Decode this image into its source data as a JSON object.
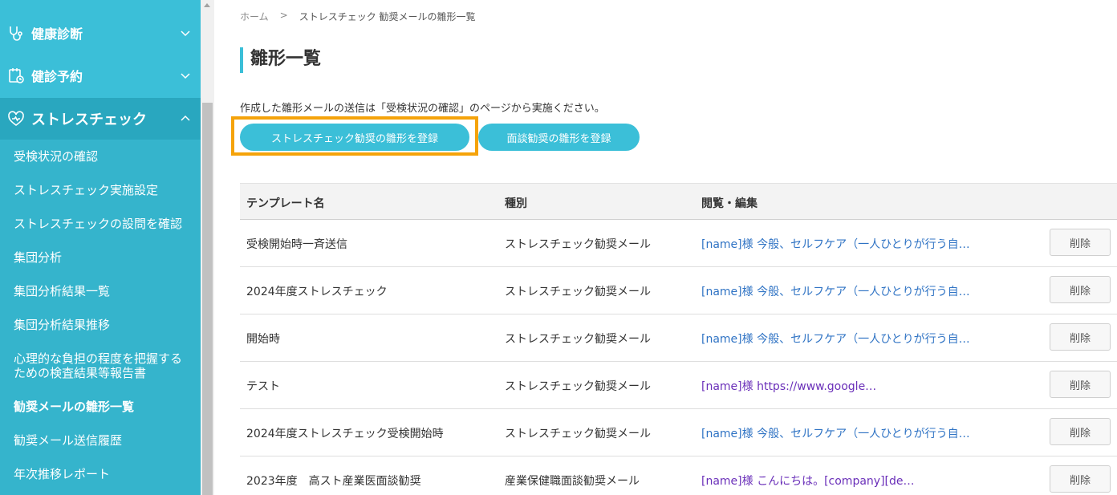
{
  "sidebar": {
    "sections": [
      {
        "label": "健康診断",
        "icon": "stethoscope-icon"
      },
      {
        "label": "健診予約",
        "icon": "calendar-clipboard-icon"
      },
      {
        "label": "ストレスチェック",
        "icon": "heart-icon"
      }
    ],
    "items": [
      {
        "label": "受検状況の確認"
      },
      {
        "label": "ストレスチェック実施設定"
      },
      {
        "label": "ストレスチェックの設問を確認"
      },
      {
        "label": "集団分析"
      },
      {
        "label": "集団分析結果一覧"
      },
      {
        "label": "集団分析結果推移"
      },
      {
        "label": "心理的な負担の程度を把握するための検査結果等報告書"
      },
      {
        "label": "勧奨メールの雛形一覧",
        "active": true
      },
      {
        "label": "勧奨メール送信履歴"
      },
      {
        "label": "年次推移レポート"
      }
    ]
  },
  "breadcrumb": {
    "home": "ホーム",
    "separator": ">",
    "current": "ストレスチェック 勧奨メールの雛形一覧"
  },
  "page": {
    "title": "雛形一覧",
    "notice": "作成した雛形メールの送信は「受検状況の確認」のページから実施ください。",
    "btn_stress": "ストレスチェック勧奨の雛形を登録",
    "btn_interview": "面談勧奨の雛形を登録"
  },
  "table": {
    "headers": {
      "name": "テンプレート名",
      "type": "種別",
      "view": "閲覧・編集"
    },
    "delete_label": "削除",
    "rows": [
      {
        "name": "受検開始時一斉送信",
        "type": "ストレスチェック勧奨メール",
        "preview": "[name]様 今般、セルフケア（一人ひとりが行う自…"
      },
      {
        "name": "2024年度ストレスチェック",
        "type": "ストレスチェック勧奨メール",
        "preview": "[name]様 今般、セルフケア（一人ひとりが行う自…"
      },
      {
        "name": "開始時",
        "type": "ストレスチェック勧奨メール",
        "preview": "[name]様 今般、セルフケア（一人ひとりが行う自…"
      },
      {
        "name": "テスト",
        "type": "ストレスチェック勧奨メール",
        "preview": "[name]様 https://www.google…"
      },
      {
        "name": "2024年度ストレスチェック受検開始時",
        "type": "ストレスチェック勧奨メール",
        "preview": "[name]様 今般、セルフケア（一人ひとりが行う自…"
      },
      {
        "name": "2023年度　高スト産業医面談勧奨",
        "type": "産業保健職面談勧奨メール",
        "preview": "[name]様 こんにちは。[company][de…"
      }
    ]
  },
  "colors": {
    "accent": "#3bbfd8",
    "highlight": "#f5a30a",
    "link": "#2f73c4",
    "visited": "#6a2fb9"
  }
}
